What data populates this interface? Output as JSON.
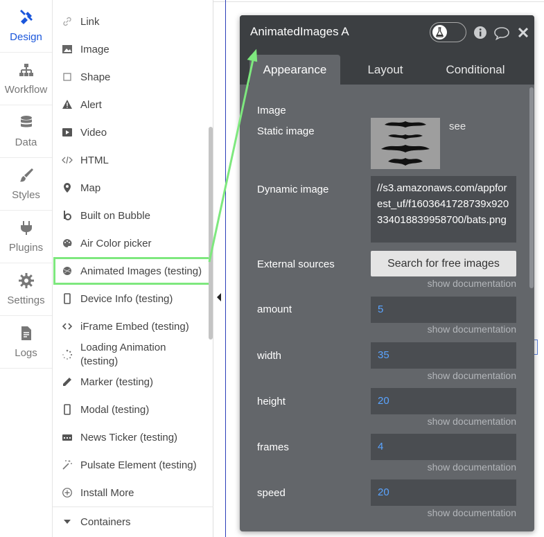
{
  "nav": {
    "design": "Design",
    "workflow": "Workflow",
    "data": "Data",
    "styles": "Styles",
    "plugins": "Plugins",
    "settings": "Settings",
    "logs": "Logs"
  },
  "elements": [
    {
      "label": "Link",
      "icon": "link-icon"
    },
    {
      "label": "Image",
      "icon": "image-icon"
    },
    {
      "label": "Shape",
      "icon": "shape-icon"
    },
    {
      "label": "Alert",
      "icon": "alert-icon"
    },
    {
      "label": "Video",
      "icon": "video-icon"
    },
    {
      "label": "HTML",
      "icon": "html-icon"
    },
    {
      "label": "Map",
      "icon": "map-pin-icon"
    },
    {
      "label": "Built on Bubble",
      "icon": "bubble-logo-icon"
    },
    {
      "label": "Air Color picker",
      "icon": "palette-icon"
    },
    {
      "label": "Animated Images (testing)",
      "icon": "plugin-ball-icon"
    },
    {
      "label": "Device Info (testing)",
      "icon": "device-icon"
    },
    {
      "label": "iFrame Embed (testing)",
      "icon": "code-icon"
    },
    {
      "label": "Loading Animation (testing)",
      "icon": "spinner-icon"
    },
    {
      "label": "Marker (testing)",
      "icon": "pen-icon"
    },
    {
      "label": "Modal (testing)",
      "icon": "device-icon"
    },
    {
      "label": "News Ticker (testing)",
      "icon": "ticker-icon"
    },
    {
      "label": "Pulsate Element (testing)",
      "icon": "sparkle-icon"
    },
    {
      "label": "Install More",
      "icon": "plus-circle-icon"
    }
  ],
  "containers_label": "Containers",
  "panel": {
    "title": "AnimatedImages A",
    "tabs": [
      "Appearance",
      "Layout",
      "Conditional"
    ],
    "image_section": "Image",
    "static_image_label": "Static image",
    "see_label": "see",
    "dynamic_image_label": "Dynamic image",
    "dynamic_image_value": "//s3.amazonaws.com/appforest_uf/f1603641728739x920334018839958700/bats.png",
    "external_sources_label": "External sources",
    "search_button": "Search for free images",
    "show_doc": "show documentation",
    "fields": [
      {
        "label": "amount",
        "value": "5"
      },
      {
        "label": "width",
        "value": "35"
      },
      {
        "label": "height",
        "value": "20"
      },
      {
        "label": "frames",
        "value": "4"
      },
      {
        "label": "speed",
        "value": "20"
      }
    ]
  }
}
